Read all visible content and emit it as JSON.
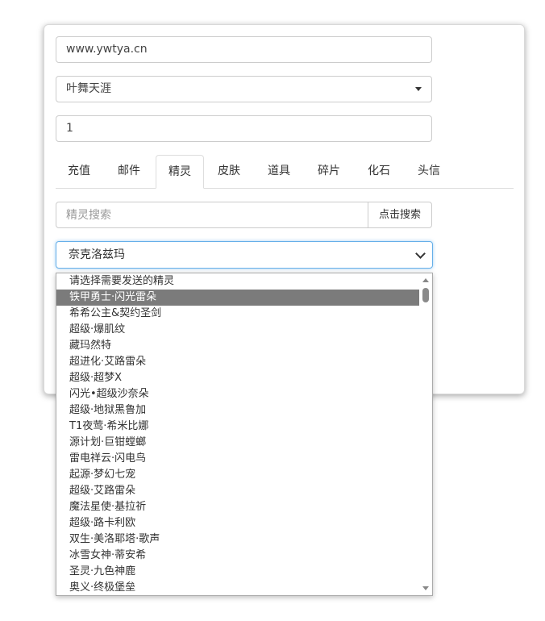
{
  "form": {
    "server_value": "www.ywtya.cn",
    "zone_select": "叶舞天涯",
    "quantity_value": "1"
  },
  "tabs": [
    {
      "label": "充值"
    },
    {
      "label": "邮件"
    },
    {
      "label": "精灵"
    },
    {
      "label": "皮肤"
    },
    {
      "label": "道具"
    },
    {
      "label": "碎片"
    },
    {
      "label": "化石"
    },
    {
      "label": "头信"
    }
  ],
  "search": {
    "placeholder": "精灵搜索",
    "button_label": "点击搜索"
  },
  "sprite_select": {
    "value": "奈克洛兹玛",
    "options": [
      "请选择需要发送的精灵",
      "铁甲勇士·闪光雷朵",
      "希希公主&契约圣剑",
      "超级·爆肌纹",
      "藏玛然特",
      "超进化·艾路雷朵",
      "超级·超梦X",
      "闪光•超级沙奈朵",
      "超级·地狱黑鲁加",
      "T1夜莺·希米比娜",
      "源计划·巨钳螳螂",
      "雷电祥云·闪电鸟",
      "起源·梦幻七宠",
      "超级·艾路雷朵",
      "魔法星使·基拉祈",
      "超级·路卡利欧",
      "双生·美洛耶塔·歌声",
      "冰雪女神·蒂安希",
      "圣灵·九色神鹿",
      "奥义·终极堡垒"
    ]
  },
  "colors": {
    "focus_border": "#66afe9",
    "highlight": "#7b7b7b"
  }
}
